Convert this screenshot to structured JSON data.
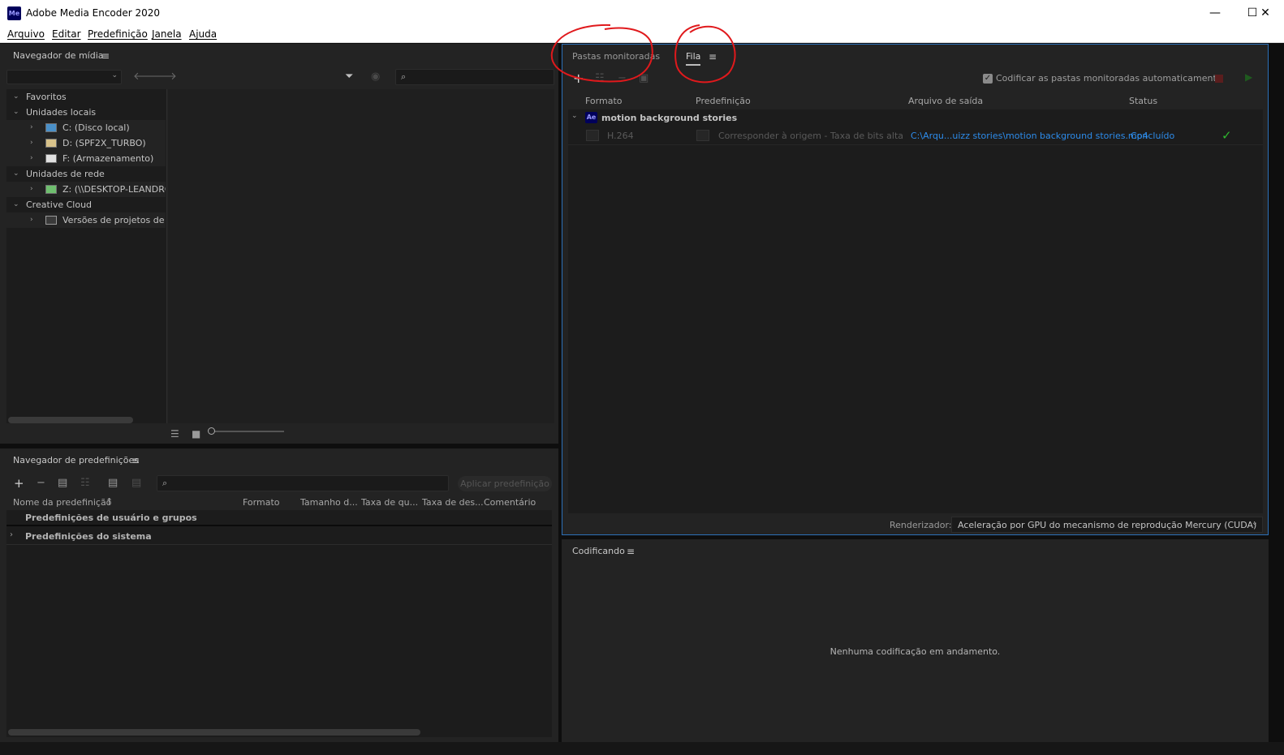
{
  "window": {
    "app_icon_text": "Me",
    "title": "Adobe Media Encoder 2020",
    "minimize_glyph": "—",
    "maximize_glyph": "☐",
    "close_glyph": "✕"
  },
  "menu": [
    "Arquivo",
    "Editar",
    "Predefinição",
    "Janela",
    "Ajuda"
  ],
  "media_browser": {
    "title": "Navegador de mídia",
    "menu_glyph": "≡",
    "tree": [
      {
        "label": "Favoritos",
        "level": 0,
        "expanded": true
      },
      {
        "label": "Unidades locais",
        "level": 0,
        "expanded": true
      },
      {
        "label": "C: (Disco local)",
        "level": 1,
        "icon": "local-drive-icon"
      },
      {
        "label": "D: (SPF2X_TURBO)",
        "level": 1,
        "icon": "custom-drive-icon"
      },
      {
        "label": "F: (Armazenamento)",
        "level": 1,
        "icon": "storage-drive-icon"
      },
      {
        "label": "Unidades de rede",
        "level": 0,
        "expanded": true
      },
      {
        "label": "Z: (\\\\DESKTOP-LEANDROV",
        "level": 1,
        "icon": "network-drive-icon"
      },
      {
        "label": "Creative Cloud",
        "level": 0,
        "expanded": true
      },
      {
        "label": "Versões de projetos de equ",
        "level": 1,
        "icon": "team-projects-icon"
      }
    ]
  },
  "preset_browser": {
    "title": "Navegador de predefinições",
    "menu_glyph": "≡",
    "apply_label": "Aplicar predefinição",
    "columns": [
      "Nome da predefinição",
      "Formato",
      "Tamanho d...",
      "Taxa de qu...",
      "Taxa de des...",
      "Comentário"
    ],
    "sort_glyph": "↑",
    "groups": [
      {
        "label": "Predefinições de usuário e grupos",
        "expandable": false
      },
      {
        "label": "Predefinições do sistema",
        "expandable": true
      }
    ]
  },
  "queue": {
    "tab_watch": "Pastas monitoradas",
    "tab_queue": "Fila",
    "menu_glyph": "≡",
    "auto_encode_label": "Codificar as pastas monitoradas automaticamente",
    "auto_encode_checked": true,
    "columns": [
      "Formato",
      "Predefinição",
      "Arquivo de saída",
      "Status"
    ],
    "group": {
      "badge": "Ae",
      "name": "motion background stories"
    },
    "items": [
      {
        "format": "H.264",
        "preset": "Corresponder à origem - Taxa de bits alta",
        "output": "C:\\Arqu...uizz stories\\motion background stories.mp4",
        "status": "Concluído"
      }
    ],
    "renderer_label": "Renderizador:",
    "renderer_value": "Aceleração por GPU do mecanismo de reprodução Mercury (CUDA)"
  },
  "encoding": {
    "title": "Codificando",
    "menu_glyph": "≡",
    "empty_message": "Nenhuma codificação em andamento."
  },
  "colors": {
    "accent_blue": "#2d8ceb",
    "done_green": "#2fb82f",
    "annotation_red": "#e0191c",
    "ae_badge": "#00005b"
  }
}
